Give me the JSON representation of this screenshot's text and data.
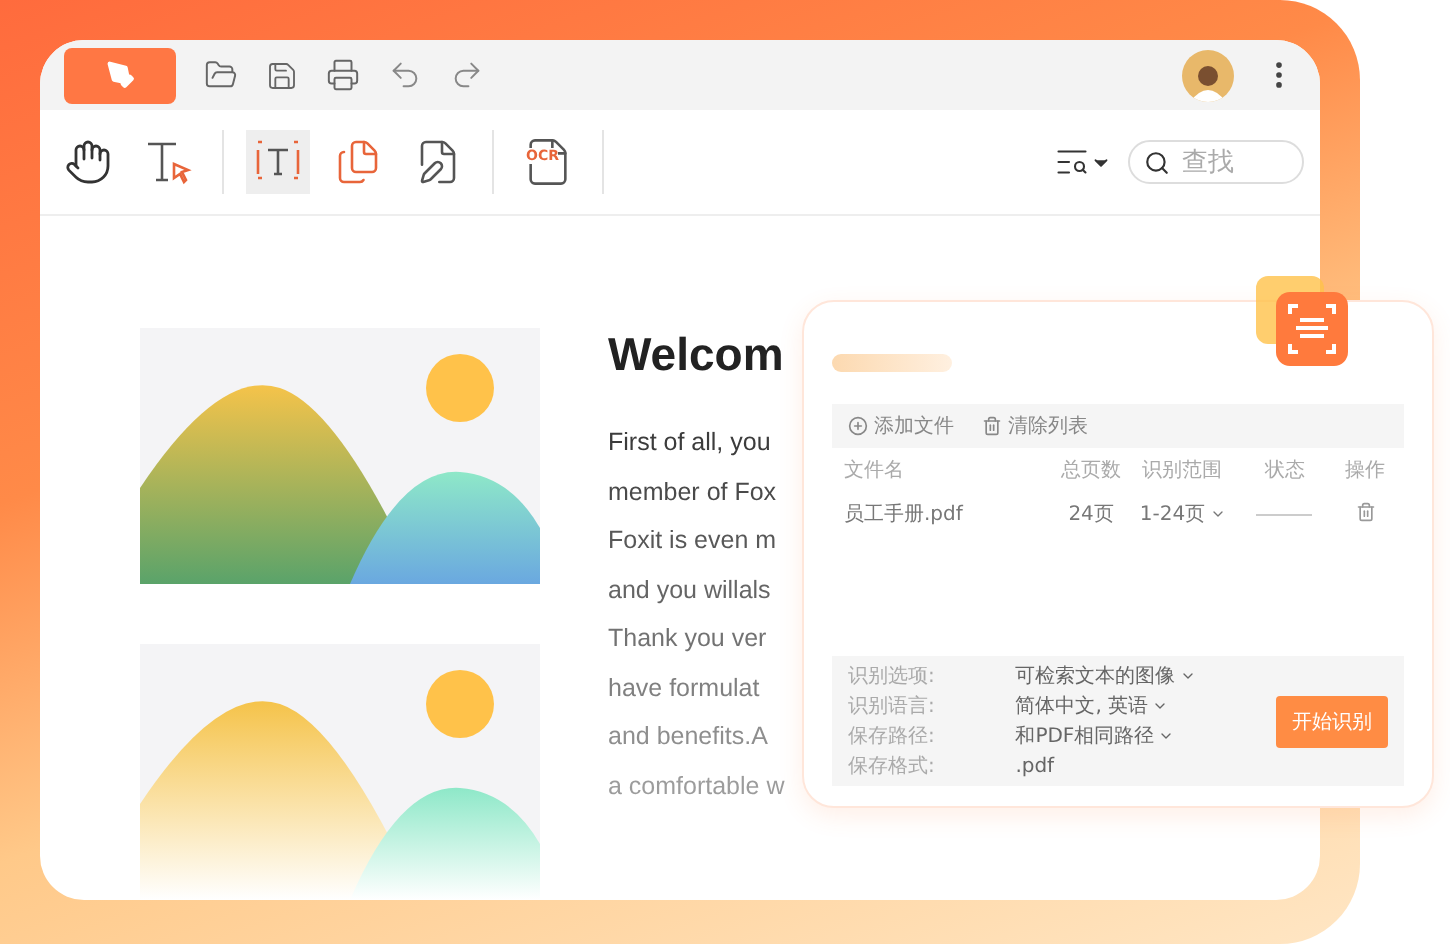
{
  "toolbar": {
    "tools": [
      {
        "kind": "hand",
        "selected": false
      },
      {
        "kind": "text-select",
        "selected": false
      },
      {
        "kind": "area-select",
        "selected": true
      },
      {
        "kind": "copy",
        "selected": false
      },
      {
        "kind": "edit",
        "selected": false
      },
      {
        "kind": "ocr",
        "selected": false,
        "label": "OCR"
      }
    ]
  },
  "search": {
    "placeholder": "查找"
  },
  "document": {
    "title": "Welcom",
    "lines": [
      "First of all, you",
      "member of Fox",
      "Foxit is even m",
      "and you willals",
      "Thank you ver",
      "have formulat",
      "and benefits.A",
      "a comfortable w"
    ]
  },
  "ocr_panel": {
    "actions": [
      "添加文件",
      "清除列表"
    ],
    "columns": [
      "文件名",
      "总页数",
      "识别范围",
      "状态",
      "操作"
    ],
    "rows": [
      {
        "file": "员工手册.pdf",
        "pages": "24页",
        "range": "1-24页"
      }
    ],
    "options": [
      {
        "label": "识别选项:",
        "value": "可检索文本的图像",
        "dropdown": true
      },
      {
        "label": "识别语言:",
        "value": "简体中文, 英语",
        "dropdown": true
      },
      {
        "label": "保存路径:",
        "value": "和PDF相同路径",
        "dropdown": true
      },
      {
        "label": "保存格式:",
        "value": ".pdf",
        "dropdown": false
      }
    ],
    "start_button": "开始识别"
  }
}
